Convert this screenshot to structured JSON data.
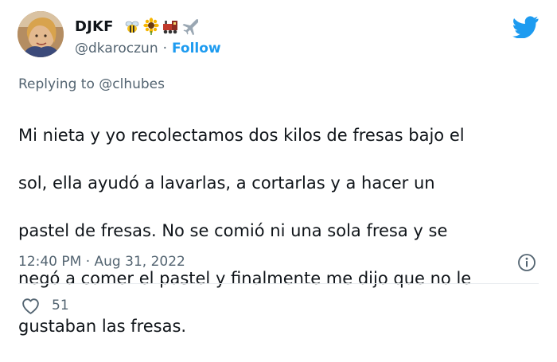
{
  "author": {
    "display_name": "DJKF",
    "emojis": [
      "bee-emoji",
      "sunflower-emoji",
      "train-emoji",
      "airplane-emoji"
    ],
    "handle": "@dkaroczun",
    "separator": "·",
    "follow_label": "Follow"
  },
  "tweet": {
    "replying_prefix": "Replying to ",
    "replying_to": "@clhubes",
    "lines": [
      "Mi nieta y yo recolectamos dos kilos de fresas bajo el",
      "sol, ella ayudó a lavarlas, a cortarlas y a hacer un",
      "pastel de fresas. No se comió ni una sola fresa y se",
      "negó a comer el pastel y finalmente me dijo que no le",
      "gustaban las fresas."
    ],
    "timestamp": "12:40 PM · Aug 31, 2022"
  },
  "engagement": {
    "likes": "51"
  },
  "colors": {
    "brand": "#1d9bf0",
    "text": "#0f1419",
    "secondary": "#536471",
    "divider": "#e7ebee"
  },
  "icons": {
    "logo": "twitter-bird-icon",
    "info": "info-icon",
    "like": "heart-icon"
  }
}
